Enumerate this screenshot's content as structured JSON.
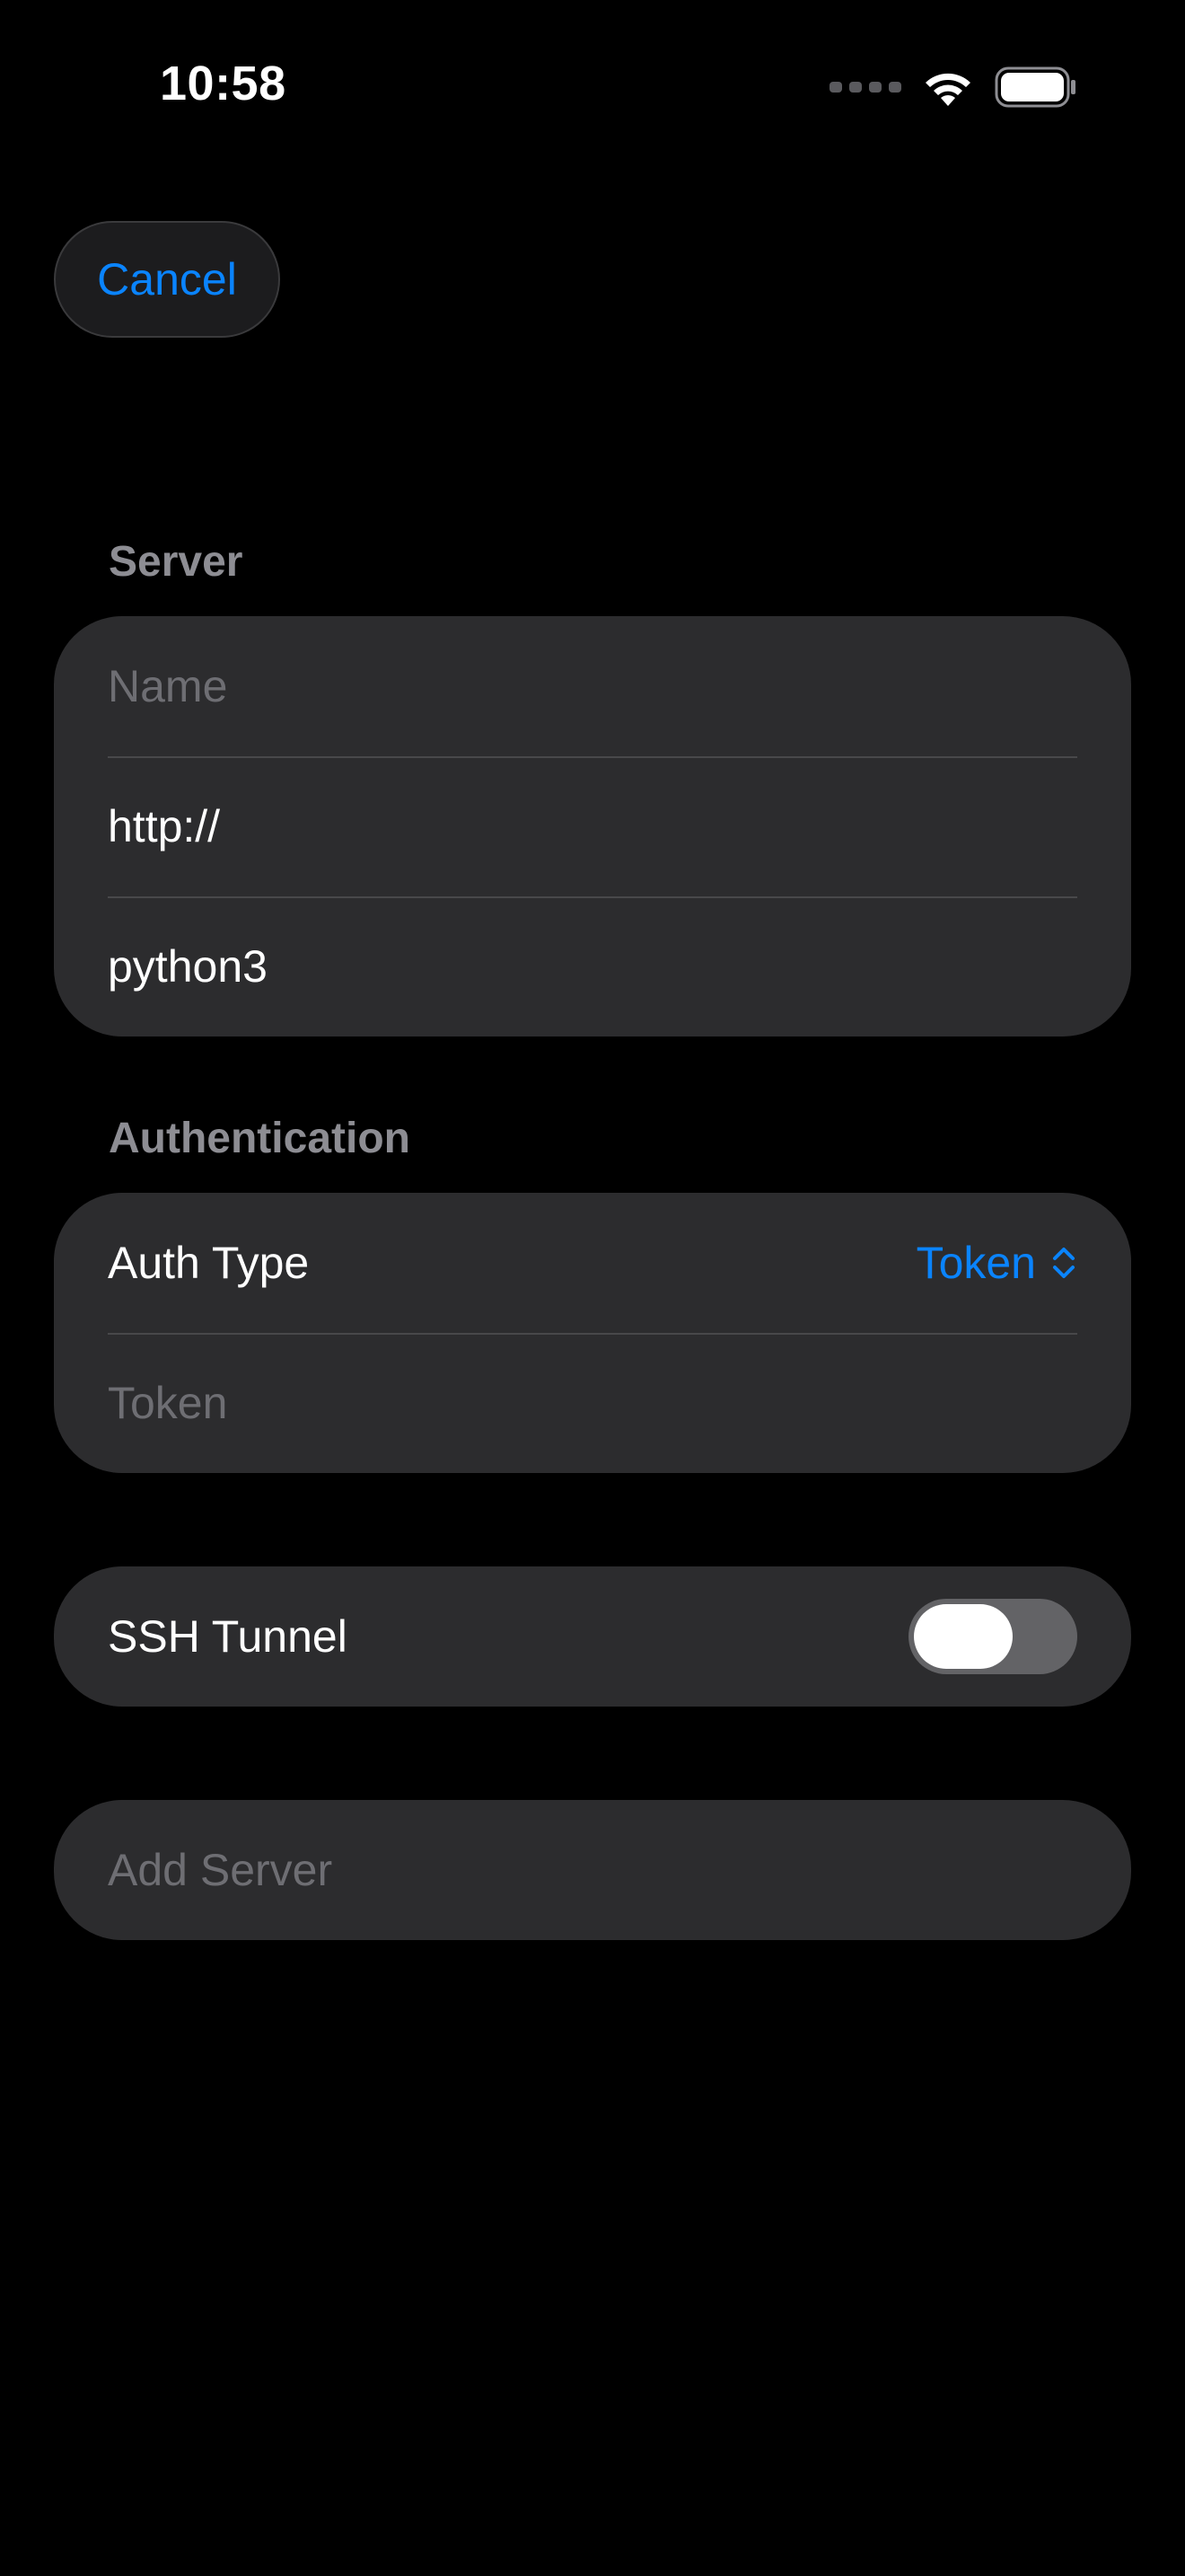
{
  "status_bar": {
    "time": "10:58",
    "icons": [
      "cellular-signal-icon",
      "wifi-icon",
      "battery-icon"
    ]
  },
  "nav": {
    "cancel_label": "Cancel"
  },
  "server_section": {
    "header": "Server",
    "fields": [
      {
        "placeholder": "Name",
        "value": ""
      },
      {
        "placeholder": "",
        "value": "http://"
      },
      {
        "placeholder": "",
        "value": "python3"
      }
    ]
  },
  "auth_section": {
    "header": "Authentication",
    "auth_type_label": "Auth Type",
    "auth_type_value": "Token",
    "token_placeholder": "Token"
  },
  "ssh_section": {
    "label": "SSH Tunnel",
    "enabled": false
  },
  "actions": {
    "add_server_label": "Add Server"
  },
  "colors": {
    "background": "#000000",
    "card": "#2c2c2e",
    "accent": "#0a84ff",
    "secondary_text": "#8d8d93",
    "placeholder": "#6e6e73"
  }
}
